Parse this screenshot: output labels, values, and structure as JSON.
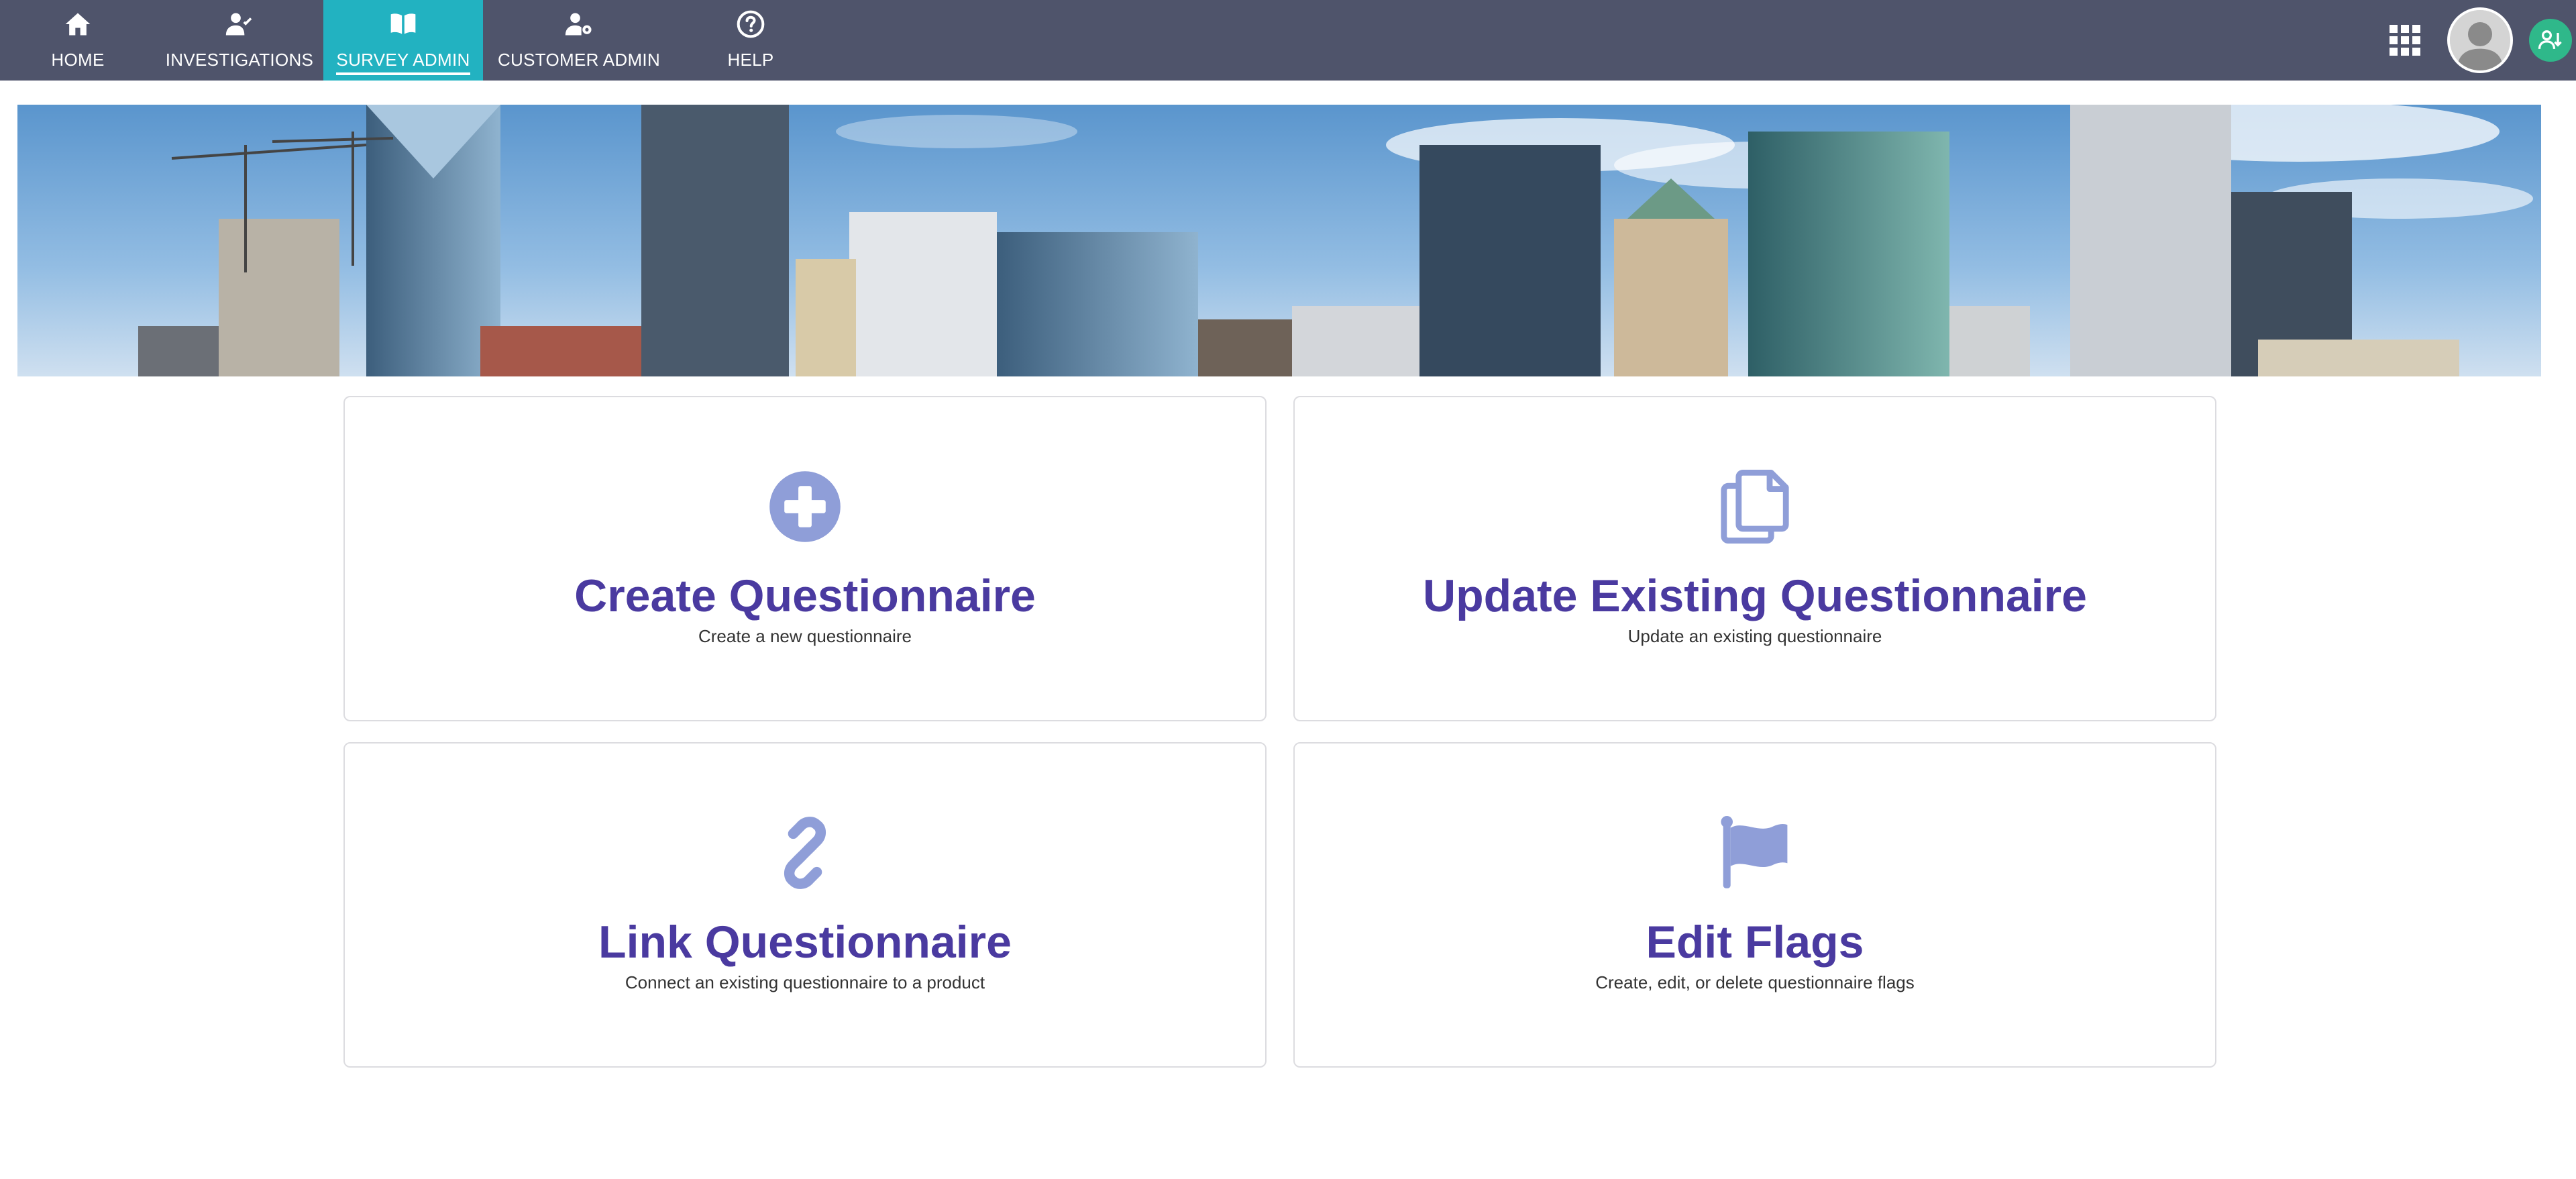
{
  "nav": {
    "items": [
      {
        "label": "HOME",
        "icon": "home-icon"
      },
      {
        "label": "INVESTIGATIONS",
        "icon": "user-check-icon"
      },
      {
        "label": "SURVEY ADMIN",
        "icon": "book-open-icon",
        "active": true
      },
      {
        "label": "CUSTOMER ADMIN",
        "icon": "user-gear-icon"
      },
      {
        "label": "HELP",
        "icon": "question-circle-icon"
      }
    ]
  },
  "header_right": {
    "apps_icon": "grid-icon",
    "avatar_icon": "user-avatar-icon",
    "status_icon": "user-status-icon"
  },
  "banner": {
    "image": "city-skyline-banner"
  },
  "cards": [
    {
      "title": "Create Questionnaire",
      "subtitle": "Create a new questionnaire",
      "icon": "plus-circle-icon"
    },
    {
      "title": "Update Existing Questionnaire",
      "subtitle": "Update an existing questionnaire",
      "icon": "copy-icon"
    },
    {
      "title": "Link Questionnaire",
      "subtitle": "Connect an existing questionnaire to a product",
      "icon": "link-icon"
    },
    {
      "title": "Edit Flags",
      "subtitle": "Create, edit, or delete questionnaire flags",
      "icon": "flag-icon"
    }
  ],
  "colors": {
    "nav_background": "#4f546b",
    "nav_active": "#22b2c1",
    "card_title": "#4a3aa0",
    "card_icon": "#8f9ed8",
    "status_green": "#2fb88a"
  }
}
